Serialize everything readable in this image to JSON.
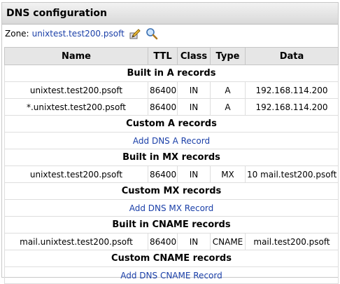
{
  "panel": {
    "title": "DNS configuration"
  },
  "zone": {
    "label": "Zone:",
    "name": "unixtest.test200.psoft"
  },
  "columns": [
    "Name",
    "TTL",
    "Class",
    "Type",
    "Data"
  ],
  "sections": {
    "builtin_a": {
      "title": "Built in A records",
      "rows": [
        {
          "name": "unixtest.test200.psoft",
          "ttl": "86400",
          "class": "IN",
          "type": "A",
          "data": "192.168.114.200"
        },
        {
          "name": "*.unixtest.test200.psoft",
          "ttl": "86400",
          "class": "IN",
          "type": "A",
          "data": "192.168.114.200"
        }
      ]
    },
    "custom_a": {
      "title": "Custom A records",
      "add_label": "Add DNS A Record"
    },
    "builtin_mx": {
      "title": "Built in MX records",
      "rows": [
        {
          "name": "unixtest.test200.psoft",
          "ttl": "86400",
          "class": "IN",
          "type": "MX",
          "data": "10 mail.test200.psoft"
        }
      ]
    },
    "custom_mx": {
      "title": "Custom MX records",
      "add_label": "Add DNS MX Record"
    },
    "builtin_cname": {
      "title": "Built in CNAME records",
      "rows": [
        {
          "name": "mail.unixtest.test200.psoft",
          "ttl": "86400",
          "class": "IN",
          "type": "CNAME",
          "data": "mail.test200.psoft"
        }
      ]
    },
    "custom_cname": {
      "title": "Custom CNAME records",
      "add_label": "Add DNS CNAME Record"
    }
  },
  "colors": {
    "link": "#1a3fa8",
    "header_bg": "#e6e6e6"
  },
  "icons": [
    "edit-zone-icon",
    "search-zone-icon"
  ]
}
